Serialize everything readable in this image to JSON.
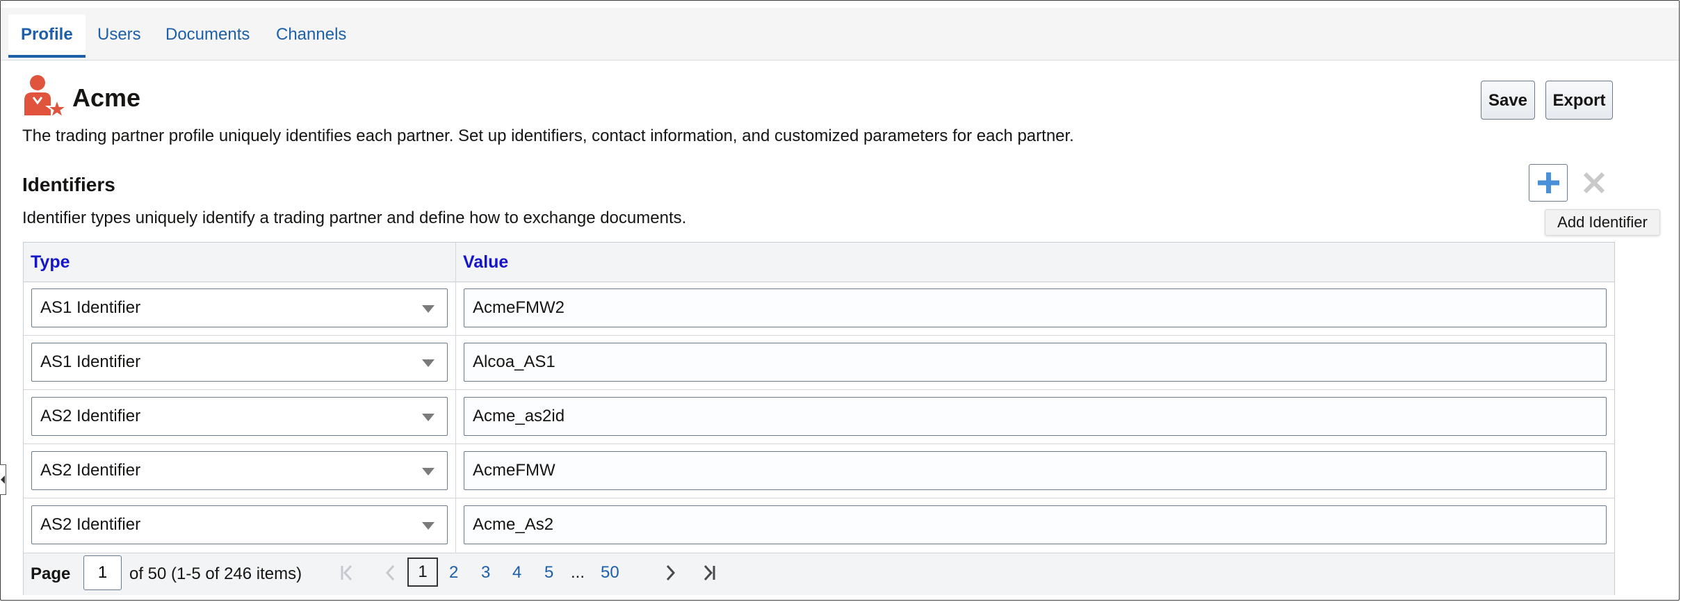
{
  "tabs": [
    {
      "label": "Profile",
      "active": true
    },
    {
      "label": "Users",
      "active": false
    },
    {
      "label": "Documents",
      "active": false
    },
    {
      "label": "Channels",
      "active": false
    }
  ],
  "partner": {
    "name": "Acme",
    "description": "The trading partner profile uniquely identifies each partner. Set up identifiers, contact information, and customized parameters for each partner."
  },
  "actions": {
    "save_label": "Save",
    "export_label": "Export"
  },
  "identifiers": {
    "title": "Identifiers",
    "description": "Identifier types uniquely identify a trading partner and define how to exchange documents.",
    "add_tooltip": "Add Identifier",
    "columns": {
      "type": "Type",
      "value": "Value"
    },
    "rows": [
      {
        "type": "AS1 Identifier",
        "value": "AcmeFMW2"
      },
      {
        "type": "AS1 Identifier",
        "value": "Alcoa_AS1"
      },
      {
        "type": "AS2 Identifier",
        "value": "Acme_as2id"
      },
      {
        "type": "AS2 Identifier",
        "value": "AcmeFMW"
      },
      {
        "type": "AS2 Identifier",
        "value": "Acme_As2"
      }
    ]
  },
  "pagination": {
    "page_label": "Page",
    "current_page": "1",
    "summary": "of 50 (1-5 of 246 items)",
    "pages": [
      "1",
      "2",
      "3",
      "4",
      "5"
    ],
    "ellipsis": "...",
    "last_page": "50"
  },
  "colors": {
    "accent": "#1d5fa8",
    "header_text": "#1515c9",
    "logo": "#e0533d"
  }
}
